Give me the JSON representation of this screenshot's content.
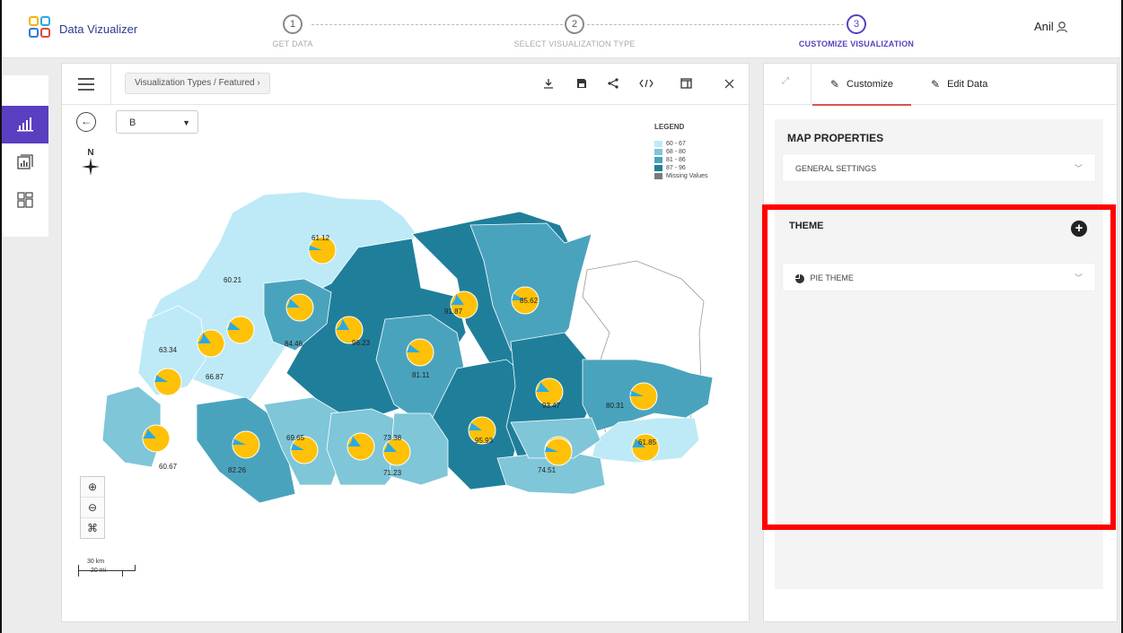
{
  "app": {
    "title": "Data Vizualizer",
    "user": "Anil"
  },
  "steps": [
    {
      "number": "1",
      "label": "GET DATA"
    },
    {
      "number": "2",
      "label": "SELECT VISUALIZATION TYPE"
    },
    {
      "number": "3",
      "label": "CUSTOMIZE VISUALIZATION"
    }
  ],
  "toolbar": {
    "breadcrumb": "Visualization Types / Featured ›"
  },
  "map": {
    "selector_value": "B",
    "compass_label": "N",
    "legend": {
      "title": "LEGEND",
      "items": [
        {
          "label": "60 - 67",
          "color": "#bdeaf6"
        },
        {
          "label": "68 - 80",
          "color": "#7fc6d8"
        },
        {
          "label": "81 - 86",
          "color": "#4aa3bd"
        },
        {
          "label": "87 - 96",
          "color": "#1f7f9a"
        },
        {
          "label": "Missing Values",
          "color": "#7a7a7a"
        }
      ]
    },
    "labels": [
      "61.12",
      "60.21",
      "63.34",
      "66.87",
      "84.46",
      "96.23",
      "91.87",
      "85.62",
      "81.11",
      "93.47",
      "80.31",
      "60.67",
      "82.26",
      "69.65",
      "73.38",
      "71.23",
      "95.93",
      "74.51",
      "61.85"
    ],
    "scale_km": "30 km",
    "scale_mi": "20 mi",
    "pie_colors": {
      "fill": "#ffc107",
      "slice": "#29a9e6"
    }
  },
  "right_panel": {
    "tabs": {
      "customize": "Customize",
      "edit_data": "Edit Data"
    },
    "map_properties": "MAP PROPERTIES",
    "general_settings": "GENERAL SETTINGS",
    "theme": "THEME",
    "pie_theme": "PIE THEME"
  },
  "colors": {
    "accent": "#5a3fc0",
    "highlight": "#ff0000"
  }
}
